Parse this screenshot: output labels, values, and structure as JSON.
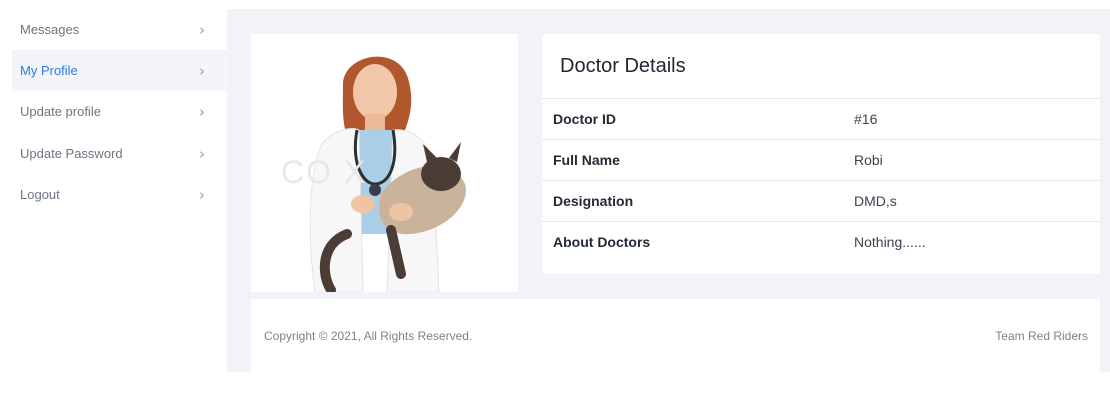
{
  "sidebar": {
    "items": [
      {
        "label": "Messages",
        "active": false
      },
      {
        "label": "My Profile",
        "active": true
      },
      {
        "label": "Update profile",
        "active": false
      },
      {
        "label": "Update Password",
        "active": false
      },
      {
        "label": "Logout",
        "active": false
      }
    ],
    "chevron": "›"
  },
  "details": {
    "title": "Doctor Details",
    "rows": [
      {
        "key": "Doctor ID",
        "value": "#16"
      },
      {
        "key": "Full Name",
        "value": "Robi"
      },
      {
        "key": "Designation",
        "value": "DMD,s"
      },
      {
        "key": "About Doctors",
        "value": "Nothing......"
      }
    ]
  },
  "photo": {
    "watermark": "CO                 X",
    "icon": "doctor-with-cat-photo"
  },
  "footer": {
    "copyright": "Copyright © 2021, All Rights Reserved.",
    "credit": "Team Red Riders"
  },
  "colors": {
    "accent": "#2d7be5",
    "main_bg": "#f2f3f9"
  }
}
